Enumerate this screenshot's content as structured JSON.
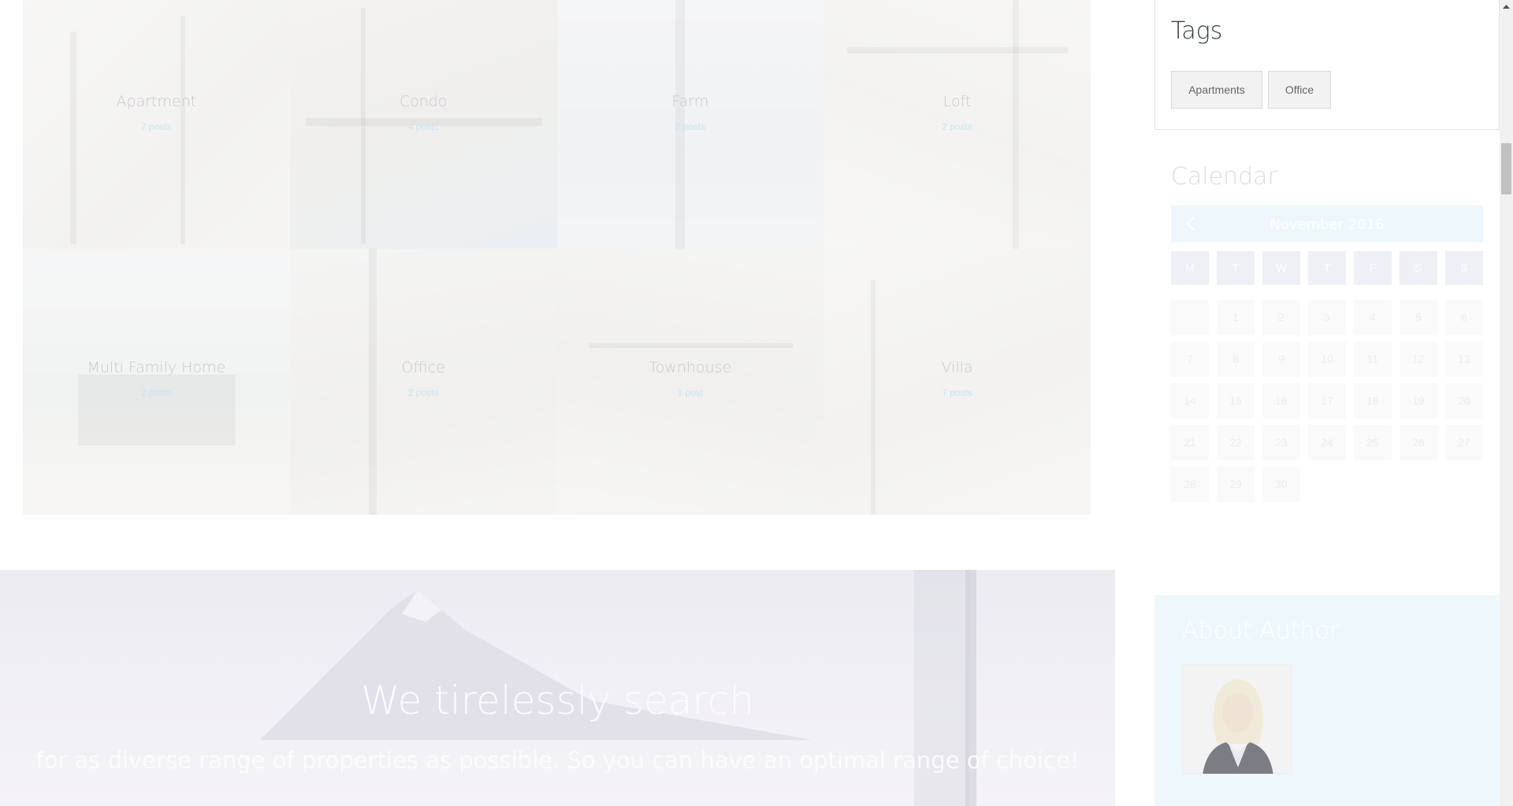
{
  "categories": [
    {
      "name": "Apartment",
      "count": "7 posts"
    },
    {
      "name": "Condo",
      "count": "4 posts"
    },
    {
      "name": "Farm",
      "count": "2 posts"
    },
    {
      "name": "Loft",
      "count": "2 posts"
    },
    {
      "name": "Multi Family Home",
      "count": "2 posts"
    },
    {
      "name": "Office",
      "count": "2 posts"
    },
    {
      "name": "Townhouse",
      "count": "1 post"
    },
    {
      "name": "Villa",
      "count": "7 posts"
    }
  ],
  "banner": {
    "title": "We tirelessly search",
    "subtitle": "for as diverse range of properties as possible. So you can have an optimal range of choice!"
  },
  "sidebar": {
    "tags": {
      "title": "Tags",
      "items": [
        "Apartments",
        "Office"
      ]
    },
    "calendar": {
      "title": "Calendar",
      "month": "November 2016",
      "weekdays": [
        "M",
        "T",
        "W",
        "T",
        "F",
        "S",
        "S"
      ],
      "dates": [
        "1",
        "2",
        "3",
        "4",
        "5",
        "6",
        "7",
        "8",
        "9",
        "10",
        "11",
        "12",
        "13",
        "14",
        "15",
        "16",
        "17",
        "18",
        "19",
        "20",
        "21",
        "22",
        "23",
        "24",
        "25",
        "26",
        "27",
        "28",
        "29",
        "30"
      ]
    },
    "about": {
      "title": "About Author"
    }
  },
  "colors": {
    "accent_light": "#eef8fc",
    "tag_bg": "#f2f2f2"
  }
}
